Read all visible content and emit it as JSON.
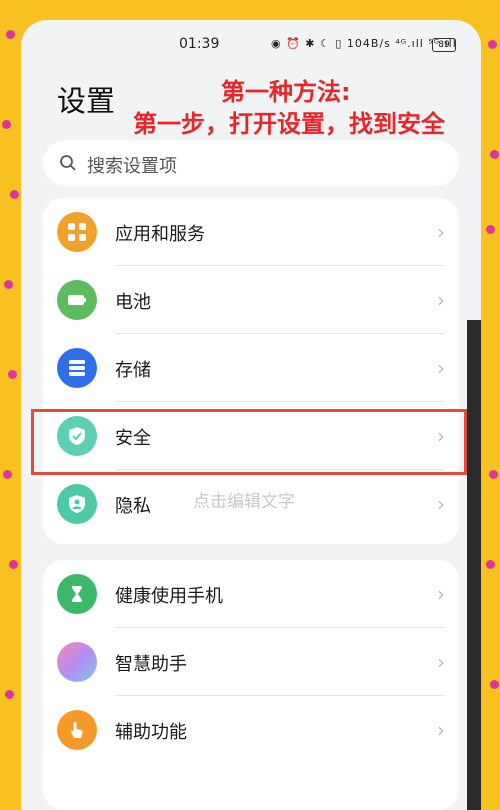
{
  "status_bar": {
    "time": "01:39",
    "icons_text": "◉ ⏰ ✱ ☾ ▯ 104B/s ⁴ᴳ.ıll ⁵ᴳ.ıll",
    "battery": "89"
  },
  "page_title": "设置",
  "annotation": {
    "line1": "第一种方法:",
    "line2": "第一步，打开设置，找到安全"
  },
  "search": {
    "placeholder": "搜索设置项"
  },
  "group1": [
    {
      "label": "应用和服务",
      "icon": "apps-icon",
      "color": "#f0a12a"
    },
    {
      "label": "电池",
      "icon": "battery-icon",
      "color": "#5cbd5e"
    },
    {
      "label": "存储",
      "icon": "storage-icon",
      "color": "#2d6fe8"
    },
    {
      "label": "安全",
      "icon": "shield-icon",
      "color": "#5ccfb4"
    },
    {
      "label": "隐私",
      "icon": "privacy-icon",
      "color": "#4ec9a8"
    }
  ],
  "group2": [
    {
      "label": "健康使用手机",
      "icon": "hourglass-icon",
      "color": "#3bb86a"
    },
    {
      "label": "智慧助手",
      "icon": "assistant-icon",
      "color": "#b58cf0"
    },
    {
      "label": "辅助功能",
      "icon": "hand-icon",
      "color": "#f59a28"
    }
  ],
  "watermark": "点击编辑文字"
}
